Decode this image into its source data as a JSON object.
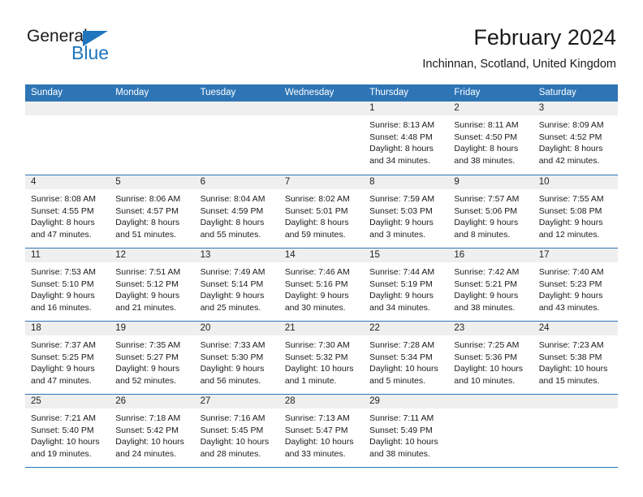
{
  "brand": {
    "name_top": "General",
    "name_bottom": "Blue",
    "triangle_icon": "triangle-icon",
    "accent_color": "#1f76bc"
  },
  "header": {
    "title": "February 2024",
    "subtitle": "Inchinnan, Scotland, United Kingdom"
  },
  "theme": {
    "header_blue": "#2e75b6",
    "day_band_gray": "#efefef",
    "text": "#1a1a1a"
  },
  "weekdays": [
    "Sunday",
    "Monday",
    "Tuesday",
    "Wednesday",
    "Thursday",
    "Friday",
    "Saturday"
  ],
  "weeks": [
    [
      {
        "day": "",
        "sunrise": "",
        "sunset": "",
        "daylight": "",
        "empty": true
      },
      {
        "day": "",
        "sunrise": "",
        "sunset": "",
        "daylight": "",
        "empty": true
      },
      {
        "day": "",
        "sunrise": "",
        "sunset": "",
        "daylight": "",
        "empty": true
      },
      {
        "day": "",
        "sunrise": "",
        "sunset": "",
        "daylight": "",
        "empty": true
      },
      {
        "day": "1",
        "sunrise": "Sunrise: 8:13 AM",
        "sunset": "Sunset: 4:48 PM",
        "daylight": "Daylight: 8 hours and 34 minutes."
      },
      {
        "day": "2",
        "sunrise": "Sunrise: 8:11 AM",
        "sunset": "Sunset: 4:50 PM",
        "daylight": "Daylight: 8 hours and 38 minutes."
      },
      {
        "day": "3",
        "sunrise": "Sunrise: 8:09 AM",
        "sunset": "Sunset: 4:52 PM",
        "daylight": "Daylight: 8 hours and 42 minutes."
      }
    ],
    [
      {
        "day": "4",
        "sunrise": "Sunrise: 8:08 AM",
        "sunset": "Sunset: 4:55 PM",
        "daylight": "Daylight: 8 hours and 47 minutes."
      },
      {
        "day": "5",
        "sunrise": "Sunrise: 8:06 AM",
        "sunset": "Sunset: 4:57 PM",
        "daylight": "Daylight: 8 hours and 51 minutes."
      },
      {
        "day": "6",
        "sunrise": "Sunrise: 8:04 AM",
        "sunset": "Sunset: 4:59 PM",
        "daylight": "Daylight: 8 hours and 55 minutes."
      },
      {
        "day": "7",
        "sunrise": "Sunrise: 8:02 AM",
        "sunset": "Sunset: 5:01 PM",
        "daylight": "Daylight: 8 hours and 59 minutes."
      },
      {
        "day": "8",
        "sunrise": "Sunrise: 7:59 AM",
        "sunset": "Sunset: 5:03 PM",
        "daylight": "Daylight: 9 hours and 3 minutes."
      },
      {
        "day": "9",
        "sunrise": "Sunrise: 7:57 AM",
        "sunset": "Sunset: 5:06 PM",
        "daylight": "Daylight: 9 hours and 8 minutes."
      },
      {
        "day": "10",
        "sunrise": "Sunrise: 7:55 AM",
        "sunset": "Sunset: 5:08 PM",
        "daylight": "Daylight: 9 hours and 12 minutes."
      }
    ],
    [
      {
        "day": "11",
        "sunrise": "Sunrise: 7:53 AM",
        "sunset": "Sunset: 5:10 PM",
        "daylight": "Daylight: 9 hours and 16 minutes."
      },
      {
        "day": "12",
        "sunrise": "Sunrise: 7:51 AM",
        "sunset": "Sunset: 5:12 PM",
        "daylight": "Daylight: 9 hours and 21 minutes."
      },
      {
        "day": "13",
        "sunrise": "Sunrise: 7:49 AM",
        "sunset": "Sunset: 5:14 PM",
        "daylight": "Daylight: 9 hours and 25 minutes."
      },
      {
        "day": "14",
        "sunrise": "Sunrise: 7:46 AM",
        "sunset": "Sunset: 5:16 PM",
        "daylight": "Daylight: 9 hours and 30 minutes."
      },
      {
        "day": "15",
        "sunrise": "Sunrise: 7:44 AM",
        "sunset": "Sunset: 5:19 PM",
        "daylight": "Daylight: 9 hours and 34 minutes."
      },
      {
        "day": "16",
        "sunrise": "Sunrise: 7:42 AM",
        "sunset": "Sunset: 5:21 PM",
        "daylight": "Daylight: 9 hours and 38 minutes."
      },
      {
        "day": "17",
        "sunrise": "Sunrise: 7:40 AM",
        "sunset": "Sunset: 5:23 PM",
        "daylight": "Daylight: 9 hours and 43 minutes."
      }
    ],
    [
      {
        "day": "18",
        "sunrise": "Sunrise: 7:37 AM",
        "sunset": "Sunset: 5:25 PM",
        "daylight": "Daylight: 9 hours and 47 minutes."
      },
      {
        "day": "19",
        "sunrise": "Sunrise: 7:35 AM",
        "sunset": "Sunset: 5:27 PM",
        "daylight": "Daylight: 9 hours and 52 minutes."
      },
      {
        "day": "20",
        "sunrise": "Sunrise: 7:33 AM",
        "sunset": "Sunset: 5:30 PM",
        "daylight": "Daylight: 9 hours and 56 minutes."
      },
      {
        "day": "21",
        "sunrise": "Sunrise: 7:30 AM",
        "sunset": "Sunset: 5:32 PM",
        "daylight": "Daylight: 10 hours and 1 minute."
      },
      {
        "day": "22",
        "sunrise": "Sunrise: 7:28 AM",
        "sunset": "Sunset: 5:34 PM",
        "daylight": "Daylight: 10 hours and 5 minutes."
      },
      {
        "day": "23",
        "sunrise": "Sunrise: 7:25 AM",
        "sunset": "Sunset: 5:36 PM",
        "daylight": "Daylight: 10 hours and 10 minutes."
      },
      {
        "day": "24",
        "sunrise": "Sunrise: 7:23 AM",
        "sunset": "Sunset: 5:38 PM",
        "daylight": "Daylight: 10 hours and 15 minutes."
      }
    ],
    [
      {
        "day": "25",
        "sunrise": "Sunrise: 7:21 AM",
        "sunset": "Sunset: 5:40 PM",
        "daylight": "Daylight: 10 hours and 19 minutes."
      },
      {
        "day": "26",
        "sunrise": "Sunrise: 7:18 AM",
        "sunset": "Sunset: 5:42 PM",
        "daylight": "Daylight: 10 hours and 24 minutes."
      },
      {
        "day": "27",
        "sunrise": "Sunrise: 7:16 AM",
        "sunset": "Sunset: 5:45 PM",
        "daylight": "Daylight: 10 hours and 28 minutes."
      },
      {
        "day": "28",
        "sunrise": "Sunrise: 7:13 AM",
        "sunset": "Sunset: 5:47 PM",
        "daylight": "Daylight: 10 hours and 33 minutes."
      },
      {
        "day": "29",
        "sunrise": "Sunrise: 7:11 AM",
        "sunset": "Sunset: 5:49 PM",
        "daylight": "Daylight: 10 hours and 38 minutes."
      },
      {
        "day": "",
        "sunrise": "",
        "sunset": "",
        "daylight": "",
        "empty": true
      },
      {
        "day": "",
        "sunrise": "",
        "sunset": "",
        "daylight": "",
        "empty": true
      }
    ]
  ]
}
